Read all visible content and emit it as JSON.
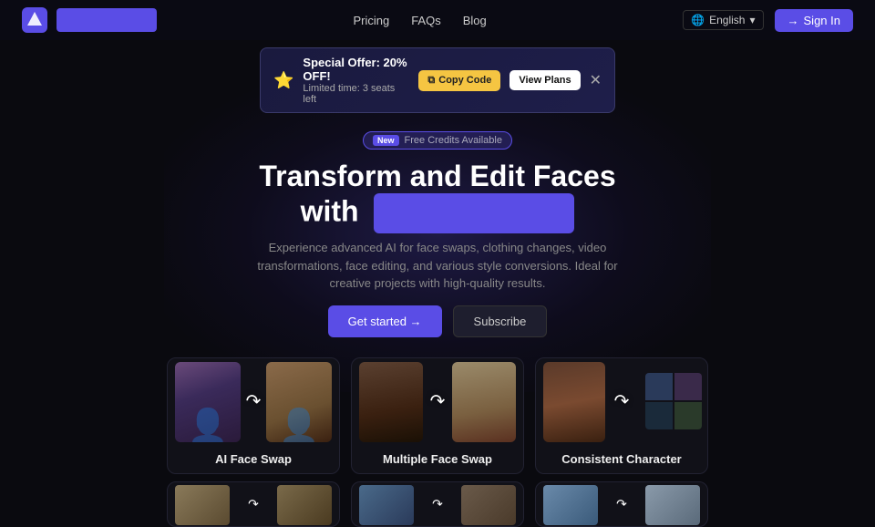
{
  "navbar": {
    "logo_text": "",
    "links": [
      {
        "label": "Pricing",
        "id": "pricing"
      },
      {
        "label": "FAQs",
        "id": "faqs"
      },
      {
        "label": "Blog",
        "id": "blog"
      }
    ],
    "language": "English",
    "sign_in_label": "Sign In"
  },
  "promo": {
    "icon": "⭐",
    "title": "Special Offer: 20% OFF!",
    "subtitle": "Limited time: 3 seats left",
    "copy_code_label": "Copy Code",
    "view_plans_label": "View Plans"
  },
  "hero": {
    "badge_new": "New",
    "badge_text": "Free Credits Available",
    "title_line1": "Transform and Edit Faces",
    "title_line2": "with",
    "title_highlight": "",
    "subtitle": "Experience advanced AI for face swaps, clothing changes, video transformations, face editing, and various style conversions. Ideal for creative projects with high-quality results.",
    "get_started_label": "Get started →",
    "subscribe_label": "Subscribe"
  },
  "feature_cards": [
    {
      "id": "ai-face-swap",
      "label": "AI Face Swap"
    },
    {
      "id": "multiple-face-swap",
      "label": "Multiple Face Swap"
    },
    {
      "id": "consistent-character",
      "label": "Consistent Character"
    }
  ],
  "bottom_cards": [
    {
      "id": "card-4",
      "label": ""
    },
    {
      "id": "card-5",
      "label": ""
    },
    {
      "id": "card-6",
      "label": ""
    }
  ]
}
